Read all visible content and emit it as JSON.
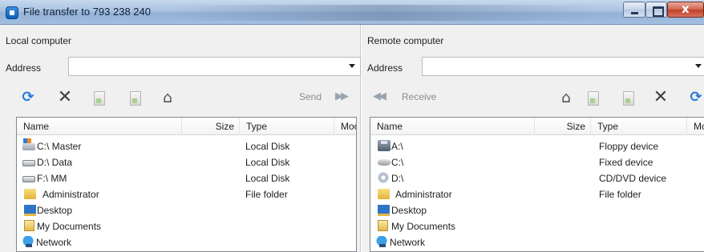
{
  "window": {
    "title": "File transfer to 793 238 240"
  },
  "local": {
    "title": "Local computer",
    "address_label": "Address",
    "address_value": "",
    "send_label": "Send",
    "columns": {
      "name": "Name",
      "size": "Size",
      "type": "Type",
      "modified": "Moc"
    },
    "items": [
      {
        "name": "C:\\ Master",
        "size": "",
        "type": "Local Disk",
        "icon": "drive-c-icon"
      },
      {
        "name": "D:\\ Data",
        "size": "",
        "type": "Local Disk",
        "icon": "drive-icon"
      },
      {
        "name": "F:\\ MM",
        "size": "",
        "type": "Local Disk",
        "icon": "drive-icon"
      },
      {
        "name": "Administrator",
        "size": "",
        "type": "File folder",
        "icon": "folder-icon"
      },
      {
        "name": "Desktop",
        "size": "",
        "type": "",
        "icon": "desktop-icon"
      },
      {
        "name": "My Documents",
        "size": "",
        "type": "",
        "icon": "documents-icon"
      },
      {
        "name": "Network",
        "size": "",
        "type": "",
        "icon": "network-icon"
      }
    ]
  },
  "remote": {
    "title": "Remote computer",
    "address_label": "Address",
    "address_value": "",
    "receive_label": "Receive",
    "columns": {
      "name": "Name",
      "size": "Size",
      "type": "Type",
      "modified": "Mc"
    },
    "items": [
      {
        "name": "A:\\",
        "size": "",
        "type": "Floppy device",
        "icon": "floppy-icon"
      },
      {
        "name": "C:\\",
        "size": "",
        "type": "Fixed device",
        "icon": "fixed-drive-icon"
      },
      {
        "name": "D:\\",
        "size": "",
        "type": "CD/DVD device",
        "icon": "cd-drive-icon"
      },
      {
        "name": "Administrator",
        "size": "",
        "type": "File folder",
        "icon": "folder-icon"
      },
      {
        "name": "Desktop",
        "size": "",
        "type": "",
        "icon": "desktop-icon"
      },
      {
        "name": "My Documents",
        "size": "",
        "type": "",
        "icon": "documents-icon"
      },
      {
        "name": "Network",
        "size": "",
        "type": "",
        "icon": "network-icon"
      }
    ]
  }
}
